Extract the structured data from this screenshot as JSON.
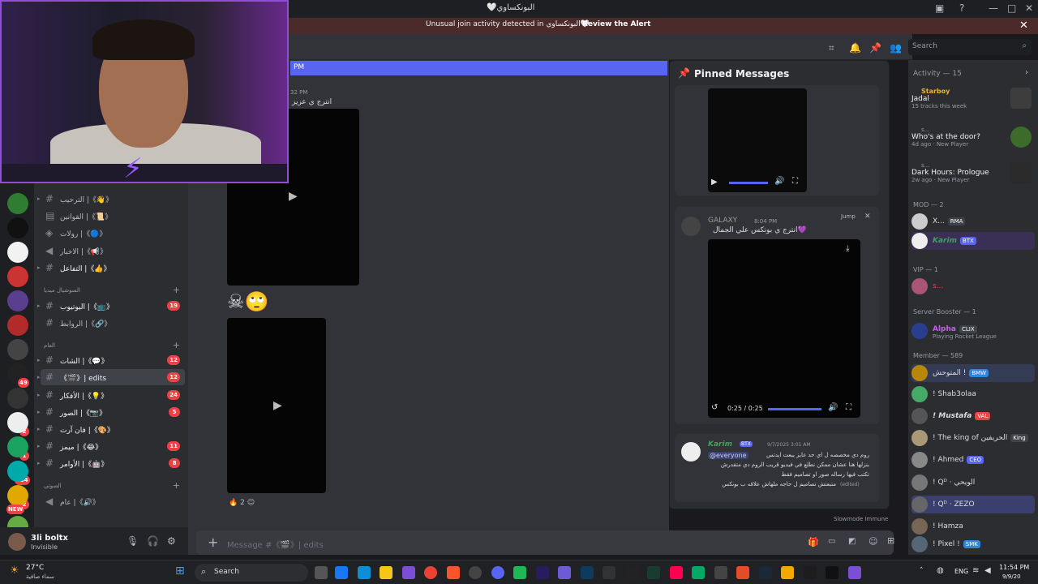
{
  "window": {
    "title": "البونكساوي🤍",
    "controls": [
      "—",
      "□",
      "✕"
    ]
  },
  "alert": {
    "text": "Unusual join activity detected in البونكساوي🤍",
    "action": "Review the Alert"
  },
  "header": {
    "search_placeholder": "Search",
    "new_messages_time": "PM"
  },
  "servers": {
    "badges": [
      "49",
      "2",
      "1",
      "284",
      "2",
      "NEW"
    ]
  },
  "channels": [
    {
      "name": "《👋》| الترحيب",
      "badge": ""
    },
    {
      "name": "《📜》| القوانين",
      "badge": ""
    },
    {
      "name": "《🔵》| رولات",
      "badge": ""
    },
    {
      "name": "《📢》| الاخبار",
      "badge": ""
    },
    {
      "name": "《👍》| التفاعل",
      "badge": ""
    },
    {
      "name": "《📺》| اليوتيوب",
      "badge": "19"
    },
    {
      "name": "《🔗》| الروابط",
      "badge": ""
    },
    {
      "name": "《💬》| الشات",
      "badge": "12"
    },
    {
      "name": "《🎬》| edits",
      "badge": "12"
    },
    {
      "name": "《💡》| الأفكار",
      "badge": "24"
    },
    {
      "name": "《📷》| الصور",
      "badge": "5"
    },
    {
      "name": "《🎨》| فان آرت",
      "badge": ""
    },
    {
      "name": "《😂》| ميمز",
      "badge": "11"
    },
    {
      "name": "《🤖》| الأوامر",
      "badge": "8"
    },
    {
      "name": "《🔊》| عام",
      "badge": ""
    }
  ],
  "categories": [
    "السوشيال ميديا",
    "العام",
    "الصوتي"
  ],
  "user": {
    "name": "3li boltx",
    "status": "Invisible"
  },
  "chat": {
    "msg_time": "32 PM",
    "msg_text": "انترج ي عزيز",
    "reaction_count": "2",
    "composer_placeholder": "Message #《🎬》| edits",
    "slowmode": "Slowmode Immune"
  },
  "pinned": {
    "title": "Pinned Messages",
    "msg1": {
      "author": "GALAXY",
      "time": "8:04 PM",
      "text": "💜انترج ي بونكس علي الجمال",
      "jump": "Jump",
      "video_time": "0:25 / 0:25"
    },
    "msg2": {
      "author": "Karim",
      "tag": "BTX",
      "time": "9/7/2025 3:01 AM",
      "mention": "@everyone",
      "line1": "روم دي مخصصه ل اي حد عايز يبعت ايدتس",
      "line2": "بنزلها هنا عشان ممكن نطلع في فيديو قريب الروم دي متقدرش",
      "line3": "تكتب فيها رساله صور او تصاميم فقط",
      "line4": "متبعتش تصاميم ل حاجه ملهاش علاقه ب بونكس",
      "edited": "(edited)"
    }
  },
  "members": {
    "activity_header": "Activity — 15",
    "activities": [
      {
        "user": "Starboy",
        "title": "Jadal",
        "sub": "15 tracks this week"
      },
      {
        "user": "s...",
        "title": "Who's at the door?",
        "sub": "4d ago · New Player"
      },
      {
        "user": "s...",
        "title": "Dark Hours: Prologue",
        "sub": "2w ago · New Player"
      }
    ],
    "groups": [
      {
        "header": "MOD — 2",
        "items": [
          {
            "name": "X...",
            "tag": "RMA"
          },
          {
            "name": "Karim",
            "tag": "BTX"
          }
        ]
      },
      {
        "header": "VIP — 1",
        "items": [
          {
            "name": "s...",
            "tag": ""
          }
        ]
      },
      {
        "header": "Server Booster — 1",
        "items": [
          {
            "name": "Alpha",
            "tag": "CLIX",
            "sub": "Playing Rocket League"
          }
        ]
      },
      {
        "header": "Member — 589",
        "items": [
          {
            "name": "! المتوحش",
            "tag": "BMW"
          },
          {
            "name": "! Shab3olaa",
            "tag": ""
          },
          {
            "name": "! Mustafa",
            "tag": "VAL"
          },
          {
            "name": "! The king of الحريفين",
            "tag": "King"
          },
          {
            "name": "! Ahmed",
            "tag": "CEO"
          },
          {
            "name": "! Qᴰ · الويحي",
            "tag": ""
          },
          {
            "name": "! Qᴰ · ZEZO",
            "tag": ""
          },
          {
            "name": "! Hamza",
            "tag": ""
          },
          {
            "name": "! Pixel !",
            "tag": "SMK"
          }
        ]
      }
    ]
  },
  "taskbar": {
    "weather_temp": "27°C",
    "weather_desc": "سماء صافية",
    "search": "Search",
    "lang": "ENG",
    "time": "11:54 PM",
    "date": "9/9/20"
  }
}
